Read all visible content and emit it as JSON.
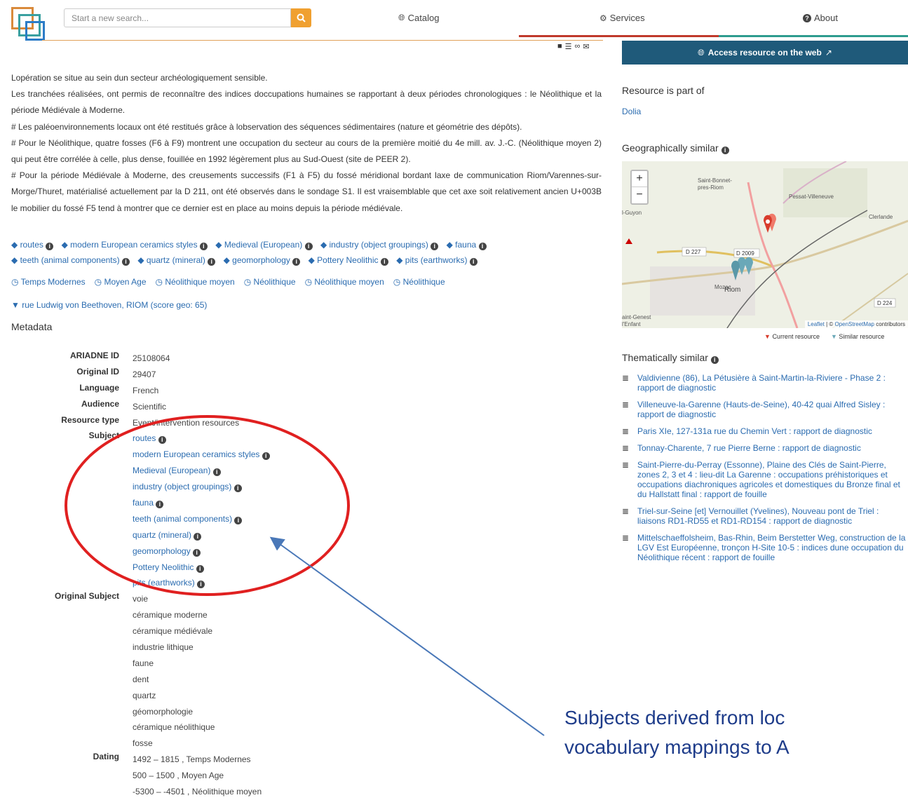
{
  "header": {
    "search_placeholder": "Start a new search...",
    "nav": [
      {
        "label": "Catalog",
        "icon": "globe-icon"
      },
      {
        "label": "Services",
        "icon": "gear-icon"
      },
      {
        "label": "About",
        "icon": "question-circle-icon"
      }
    ],
    "colors": {
      "orange": "#f0a030",
      "accent": "#1f5a7a"
    }
  },
  "description": [
    "Lopération se situe au sein dun secteur archéologiquement sensible.",
    "Les tranchées réalisées, ont permis de reconnaître des indices doccupations humaines se rapportant à deux périodes chronologiques : le Néolithique et la période Médiévale à Moderne.",
    "# Les paléoenvironnements locaux ont été restitués grâce à lobservation des séquences sédimentaires (nature et géométrie des dépôts).",
    "# Pour le Néolithique, quatre fosses (F6 à F9) montrent une occupation du secteur au cours de la première moitié du 4e mill. av. J.-C. (Néolithique moyen 2) qui peut être corrélée à celle, plus dense, fouillée en 1992 légèrement plus au Sud-Ouest (site de PEER 2).",
    "# Pour la période Médiévale à Moderne, des creusements successifs (F1 à F5) du fossé méridional bordant laxe de communication Riom/Varennes-sur-Morge/Thuret, matérialisé actuellement par la D 211, ont été observés dans le sondage S1. Il est vraisemblable que cet axe soit relativement ancien U+003B le mobilier du fossé F5 tend à montrer que ce dernier est en place au moins depuis la période médiévale."
  ],
  "tags": [
    "routes",
    "modern European ceramics styles",
    "Medieval (European)",
    "industry (object groupings)",
    "fauna",
    "teeth (animal components)",
    "quartz (mineral)",
    "geomorphology",
    "Pottery Neolithic",
    "pits (earthworks)"
  ],
  "periods": [
    "Temps Modernes",
    "Moyen Age",
    "Néolithique moyen",
    "Néolithique",
    "Néolithique moyen",
    "Néolithique"
  ],
  "place": "rue Ludwig von Beethoven, RIOM (score geo: 65)",
  "metadata": {
    "title": "Metadata",
    "ariadne_id_label": "ARIADNE ID",
    "ariadne_id": "25108064",
    "original_id_label": "Original ID",
    "original_id": "29407",
    "language_label": "Language",
    "language": "French",
    "audience_label": "Audience",
    "audience": "Scientific",
    "resource_type_label": "Resource type",
    "resource_type": "Event/intervention resources",
    "subject_label": "Subject",
    "subjects": [
      "routes",
      "modern European ceramics styles",
      "Medieval (European)",
      "industry (object groupings)",
      "fauna",
      "teeth (animal components)",
      "quartz (mineral)",
      "geomorphology",
      "Pottery Neolithic",
      "pits (earthworks)"
    ],
    "original_subject_label": "Original Subject",
    "original_subjects": [
      "voie",
      "céramique moderne",
      "céramique médiévale",
      "industrie lithique",
      "faune",
      "dent",
      "quartz",
      "géomorphologie",
      "céramique néolithique",
      "fosse"
    ],
    "dating_label": "Dating",
    "dating": [
      "1492 – 1815 , Temps Modernes",
      "500 – 1500 , Moyen Age",
      "-5300 – -4501 , Néolithique moyen"
    ]
  },
  "right": {
    "access_label": "Access resource on the web",
    "part_of_title": "Resource is part of",
    "part_of": "Dolia",
    "geo_title": "Geographically similar",
    "map_labels": {
      "saint_bonnet": "Saint-Bonnet-\npres-Riom",
      "pessat": "Pessat-Villeneuve",
      "clerlande": "Clerlande",
      "guyon": "l-Guyon",
      "d227": "D 227",
      "d2009": "D 2009",
      "mozac": "Mozac",
      "riom": "Riom",
      "d224": "D 224",
      "saint_genest": "aint-Genest\nl'Enfant",
      "attribution_leaflet": "Leaflet",
      "attribution_osm": "OpenStreetMap",
      "attribution_rest": "contributors"
    },
    "legend_current": "Current resource",
    "legend_similar": "Similar resource",
    "them_title": "Thematically similar",
    "thematic": [
      "Valdivienne (86), La Pétusière à Saint-Martin-la-Riviere - Phase 2 : rapport de diagnostic",
      "Villeneuve-la-Garenne (Hauts-de-Seine), 40-42 quai Alfred Sisley : rapport de diagnostic",
      "Paris XIe, 127-131a rue du Chemin Vert : rapport de diagnostic",
      "Tonnay-Charente, 7 rue Pierre Berne : rapport de diagnostic",
      "Saint-Pierre-du-Perray (Essonne), Plaine des Clés de Saint-Pierre, zones 2, 3 et 4 : lieu-dit La Garenne : occupations préhistoriques et occupations diachroniques agricoles et domestiques du Bronze final et du Hallstatt final : rapport de fouille",
      "Triel-sur-Seine [et] Vernouillet (Yvelines), Nouveau pont de Triel : liaisons RD1-RD55 et RD1-RD154 : rapport de diagnostic",
      "Mittelschaeffolsheim, Bas-Rhin, Beim Berstetter Weg, construction de la LGV Est Européenne, tronçon H-Site 10-5 : indices dune occupation du Néolithique récent : rapport de fouille"
    ]
  },
  "annotation": {
    "line1": "Subjects derived from loc",
    "line2": "vocabulary mappings to A"
  }
}
